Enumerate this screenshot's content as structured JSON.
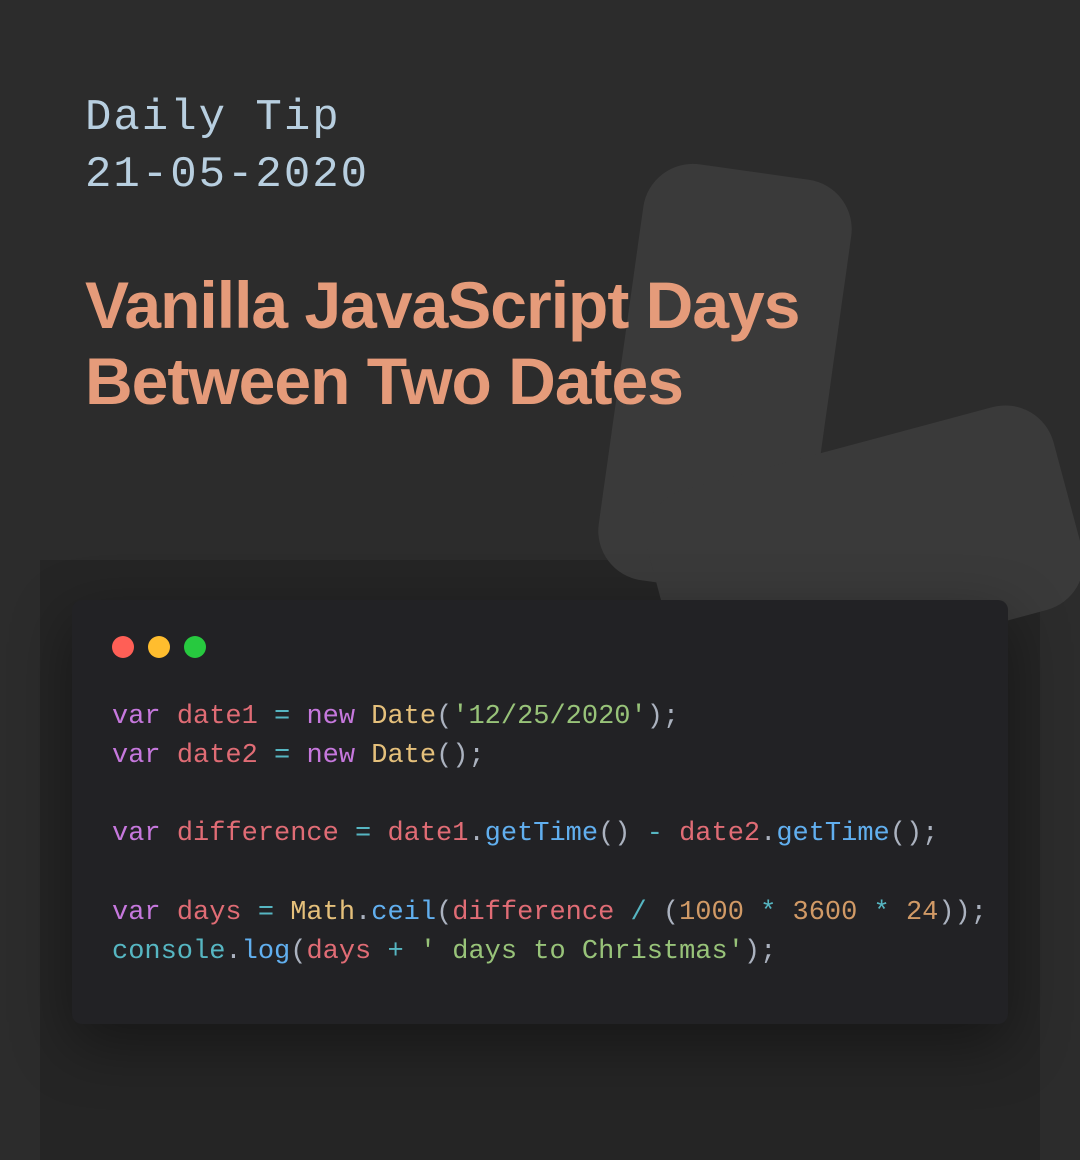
{
  "header": {
    "subtitle_line1": "Daily Tip",
    "subtitle_line2": "21-05-2020",
    "title": "Vanilla JavaScript Days Between Two Dates"
  },
  "code": {
    "l1": {
      "kw": "var",
      "sp": " ",
      "name": "date1",
      "sp2": " ",
      "eq": "=",
      "sp3": " ",
      "new": "new",
      "sp4": " ",
      "cls": "Date",
      "open": "(",
      "str": "'12/25/2020'",
      "close": ");"
    },
    "l2": {
      "kw": "var",
      "sp": " ",
      "name": "date2",
      "sp2": " ",
      "eq": "=",
      "sp3": " ",
      "new": "new",
      "sp4": " ",
      "cls": "Date",
      "open": "(",
      "close": ");"
    },
    "l4": {
      "kw": "var",
      "sp": " ",
      "name": "difference",
      "sp2": " ",
      "eq": "=",
      "sp3": " ",
      "v1": "date1",
      "dot1": ".",
      "fn1": "getTime",
      "call1": "()",
      "sp4": " ",
      "minus": "-",
      "sp5": " ",
      "v2": "date2",
      "dot2": ".",
      "fn2": "getTime",
      "call2": "();"
    },
    "l6": {
      "kw": "var",
      "sp": " ",
      "name": "days",
      "sp2": " ",
      "eq": "=",
      "sp3": " ",
      "obj": "Math",
      "dot": ".",
      "fn": "ceil",
      "open": "(",
      "arg": "difference",
      "sp4": " ",
      "div": "/",
      "sp5": " ",
      "open2": "(",
      "n1": "1000",
      "sp6": " ",
      "mul1": "*",
      "sp7": " ",
      "n2": "3600",
      "sp8": " ",
      "mul2": "*",
      "sp9": " ",
      "n3": "24",
      "close": "));"
    },
    "l7": {
      "obj": "console",
      "dot": ".",
      "fn": "log",
      "open": "(",
      "arg": "days",
      "sp": " ",
      "plus": "+",
      "sp2": " ",
      "str": "' days to Christmas'",
      "close": ");"
    }
  }
}
